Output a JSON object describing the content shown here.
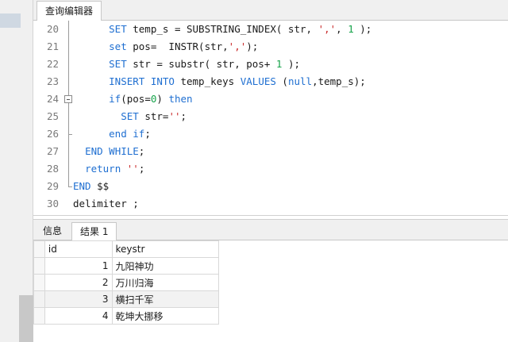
{
  "editor_tab": {
    "label": "查询编辑器"
  },
  "code_lines": [
    {
      "num": "20",
      "indent": "      ",
      "tokens": [
        [
          "kw",
          "SET"
        ],
        [
          "t",
          " temp_s = SUBSTRING_INDEX( str, "
        ],
        [
          "str",
          "','"
        ],
        [
          "t",
          ", "
        ],
        [
          "num",
          "1"
        ],
        [
          "t",
          " );"
        ]
      ]
    },
    {
      "num": "21",
      "indent": "      ",
      "tokens": [
        [
          "kw",
          "set"
        ],
        [
          "t",
          " pos=  INSTR(str,"
        ],
        [
          "str",
          "','"
        ],
        [
          "t",
          ");"
        ]
      ]
    },
    {
      "num": "22",
      "indent": "      ",
      "tokens": [
        [
          "kw",
          "SET"
        ],
        [
          "t",
          " str = substr( str, pos+ "
        ],
        [
          "num",
          "1"
        ],
        [
          "t",
          " );"
        ]
      ]
    },
    {
      "num": "23",
      "indent": "      ",
      "tokens": [
        [
          "kw",
          "INSERT INTO"
        ],
        [
          "t",
          " temp_keys "
        ],
        [
          "kw",
          "VALUES"
        ],
        [
          "t",
          " ("
        ],
        [
          "kw",
          "null"
        ],
        [
          "t",
          ",temp_s);"
        ]
      ]
    },
    {
      "num": "24",
      "indent": "      ",
      "tokens": [
        [
          "kw",
          "if"
        ],
        [
          "t",
          "(pos="
        ],
        [
          "num",
          "0"
        ],
        [
          "t",
          ") "
        ],
        [
          "kw",
          "then"
        ]
      ]
    },
    {
      "num": "25",
      "indent": "        ",
      "tokens": [
        [
          "kw",
          "SET"
        ],
        [
          "t",
          " str="
        ],
        [
          "str",
          "''"
        ],
        [
          "t",
          ";"
        ]
      ]
    },
    {
      "num": "26",
      "indent": "      ",
      "tokens": [
        [
          "kw",
          "end if"
        ],
        [
          "t",
          ";"
        ]
      ]
    },
    {
      "num": "27",
      "indent": "  ",
      "tokens": [
        [
          "kw",
          "END WHILE"
        ],
        [
          "t",
          ";"
        ]
      ]
    },
    {
      "num": "28",
      "indent": "  ",
      "tokens": [
        [
          "kw",
          "return"
        ],
        [
          "t",
          " "
        ],
        [
          "str",
          "''"
        ],
        [
          "t",
          ";"
        ]
      ]
    },
    {
      "num": "29",
      "indent": "",
      "tokens": [
        [
          "kw",
          "END"
        ],
        [
          "t",
          " $$"
        ]
      ]
    },
    {
      "num": "30",
      "indent": "",
      "tokens": [
        [
          "t",
          "delimiter ;"
        ]
      ]
    }
  ],
  "result_tabs": {
    "info": "信息",
    "result": "结果 1"
  },
  "grid": {
    "columns": [
      "id",
      "keystr"
    ],
    "rows": [
      [
        "1",
        "九阳神功"
      ],
      [
        "2",
        "万川归海"
      ],
      [
        "3",
        "横扫千军"
      ],
      [
        "4",
        "乾坤大挪移"
      ]
    ]
  },
  "colors": {
    "keyword": "#1f6fd1",
    "number": "#16a34a",
    "string": "#c92a2a"
  }
}
